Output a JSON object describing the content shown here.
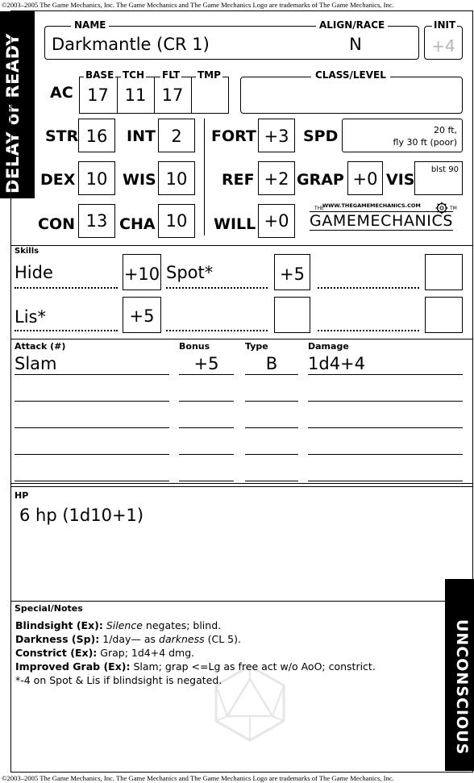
{
  "copyright": "©2003–2005 The Game Mechanics, Inc. The Game Mechanics and The Game Mechanics Logo are trademarks of The Game Mechanics, Inc.",
  "side_tab_top": "DELAY or READY",
  "side_tab_bottom": "UNCONSCIOUS",
  "header": {
    "name_label": "NAME",
    "name": "Darkmantle (CR 1)",
    "align_label": "ALIGN/RACE",
    "align": "N",
    "init_label": "INIT",
    "init": "+4"
  },
  "ac": {
    "label": "AC",
    "base_label": "BASE",
    "base": "17",
    "tch_label": "TCH",
    "tch": "11",
    "flt_label": "FLT",
    "flt": "17",
    "tmp_label": "TMP",
    "tmp": "",
    "class_label": "CLASS/LEVEL",
    "class": ""
  },
  "abilities": {
    "str_label": "STR",
    "str": "16",
    "int_label": "INT",
    "int": "2",
    "dex_label": "DEX",
    "dex": "10",
    "wis_label": "WIS",
    "wis": "10",
    "con_label": "CON",
    "con": "13",
    "cha_label": "CHA",
    "cha": "10"
  },
  "saves": {
    "fort_label": "FORT",
    "fort": "+3",
    "ref_label": "REF",
    "ref": "+2",
    "will_label": "WILL",
    "will": "+0"
  },
  "misc": {
    "spd_label": "SPD",
    "spd_line1": "20 ft,",
    "spd_line2": "fly 30 ft (poor)",
    "grap_label": "GRAP",
    "grap": "+0",
    "vis_label": "VIS",
    "vis": "blst 90"
  },
  "logo": {
    "url": "WWW.THEGAMEMECHANICS.COM",
    "the": "THE",
    "name": "GAMEMECHANICS",
    "tm": "TM"
  },
  "skills": {
    "label": "Skills",
    "items": [
      {
        "name": "Hide",
        "value": "+10"
      },
      {
        "name": "Spot*",
        "value": "+5"
      },
      {
        "name": "Lis*",
        "value": "+5"
      }
    ]
  },
  "attack": {
    "attack_label": "Attack (#)",
    "bonus_label": "Bonus",
    "type_label": "Type",
    "damage_label": "Damage",
    "rows": [
      {
        "attack": "Slam",
        "bonus": "+5",
        "type": "B",
        "damage": "1d4+4"
      }
    ]
  },
  "hp": {
    "label": "HP",
    "value": "6 hp (1d10+1)"
  },
  "notes": {
    "label": "Special/Notes",
    "lines": [
      {
        "head": "Blindsight (Ex):",
        "pre": "",
        "em": "Silence",
        "post": " negates; blind."
      },
      {
        "head": "Darkness (Sp):",
        "pre": " 1/day— as ",
        "em": "darkness",
        "post": " (CL 5)."
      },
      {
        "head": "Constrict (Ex):",
        "pre": " Grap; 1d4+4 dmg.",
        "em": "",
        "post": ""
      },
      {
        "head": "Improved Grab (Ex):",
        "pre": " Slam; grap <=Lg as free act w/o AoO; constrict.",
        "em": "",
        "post": ""
      },
      {
        "head": "",
        "pre": "*-4 on Spot & Lis if blindsight is negated.",
        "em": "",
        "post": ""
      }
    ]
  }
}
